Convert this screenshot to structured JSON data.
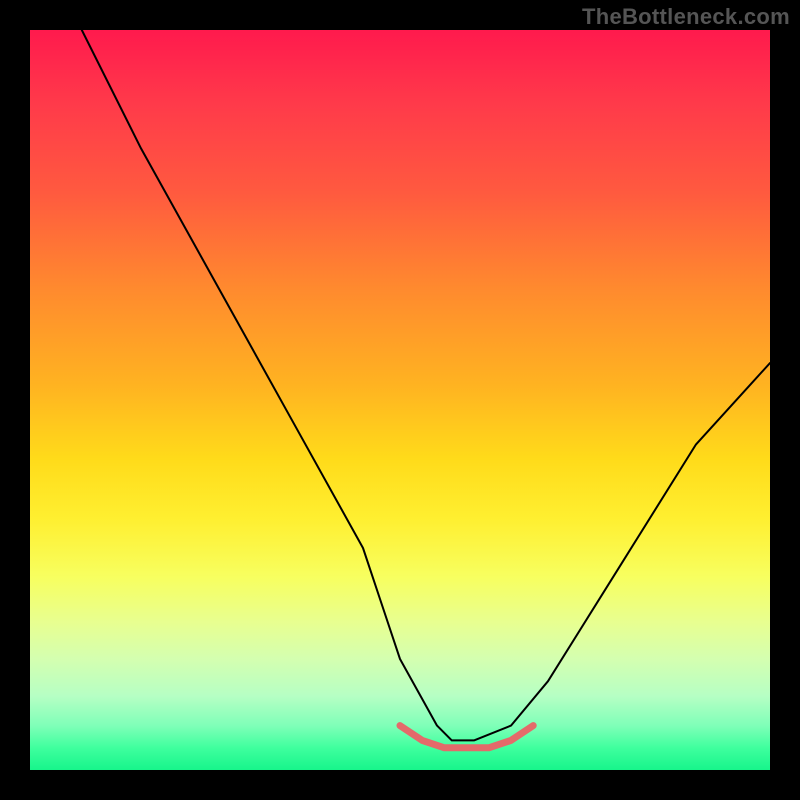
{
  "watermark": "TheBottleneck.com",
  "chart_data": {
    "type": "line",
    "title": "",
    "xlabel": "",
    "ylabel": "",
    "xlim": [
      0,
      100
    ],
    "ylim": [
      0,
      100
    ],
    "grid": false,
    "legend": false,
    "annotations": [],
    "background_gradient_stops": [
      {
        "pct": 0,
        "color": "#ff1a4d"
      },
      {
        "pct": 50,
        "color": "#ffd21a"
      },
      {
        "pct": 80,
        "color": "#f0ff80"
      },
      {
        "pct": 100,
        "color": "#17f58b"
      }
    ],
    "series": [
      {
        "name": "bottleneck-curve-black",
        "stroke": "#000000",
        "stroke_width": 2,
        "x": [
          7,
          15,
          25,
          35,
          45,
          50,
          55,
          57,
          60,
          65,
          70,
          80,
          90,
          100
        ],
        "values": [
          100,
          84,
          66,
          48,
          30,
          15,
          6,
          4,
          4,
          6,
          12,
          28,
          44,
          55
        ]
      },
      {
        "name": "bottleneck-valley-pink",
        "stroke": "#e46a6a",
        "stroke_width": 7,
        "x": [
          50,
          53,
          56,
          59,
          62,
          65,
          68
        ],
        "values": [
          6,
          4,
          3,
          3,
          3,
          4,
          6
        ]
      }
    ]
  }
}
